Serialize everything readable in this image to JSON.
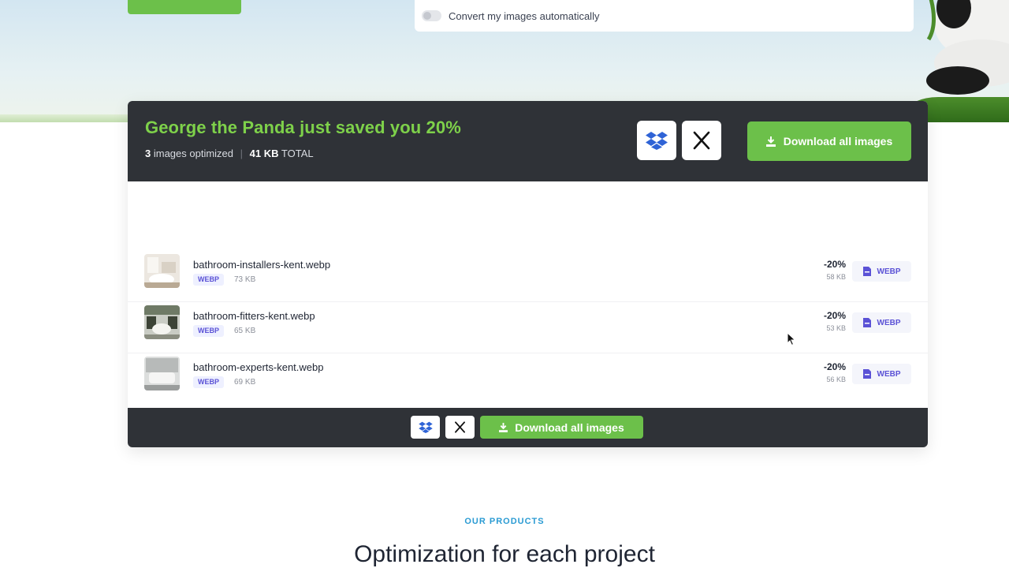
{
  "hero": {
    "convert_toggle_label": "Convert my images automatically"
  },
  "results": {
    "title": "George the Panda just saved you 20%",
    "count": "3",
    "count_label": "images optimized",
    "separator": "|",
    "total_size": "41 KB",
    "total_label": "TOTAL",
    "download_all_label": "Download all images",
    "files": [
      {
        "name": "bathroom-installers-kent.webp",
        "format": "WEBP",
        "original_size": "73 KB",
        "saving": "-20%",
        "new_size": "58 KB",
        "download_format": "WEBP"
      },
      {
        "name": "bathroom-fitters-kent.webp",
        "format": "WEBP",
        "original_size": "65 KB",
        "saving": "-20%",
        "new_size": "53 KB",
        "download_format": "WEBP"
      },
      {
        "name": "bathroom-experts-kent.webp",
        "format": "WEBP",
        "original_size": "69 KB",
        "saving": "-20%",
        "new_size": "56 KB",
        "download_format": "WEBP"
      }
    ],
    "footer_download_label": "Download all images"
  },
  "products": {
    "eyebrow": "OUR PRODUCTS",
    "title": "Optimization for each project"
  },
  "colors": {
    "accent_green": "#6cc04a",
    "title_green": "#7ed14a",
    "dark_panel": "#2f3237",
    "badge_purple": "#5b52d6",
    "eyebrow_blue": "#2b9bd3",
    "dropbox_blue": "#2f63d6"
  },
  "icons": [
    "dropbox-icon",
    "x-twitter-icon",
    "download-icon",
    "file-icon",
    "cursor-icon"
  ]
}
